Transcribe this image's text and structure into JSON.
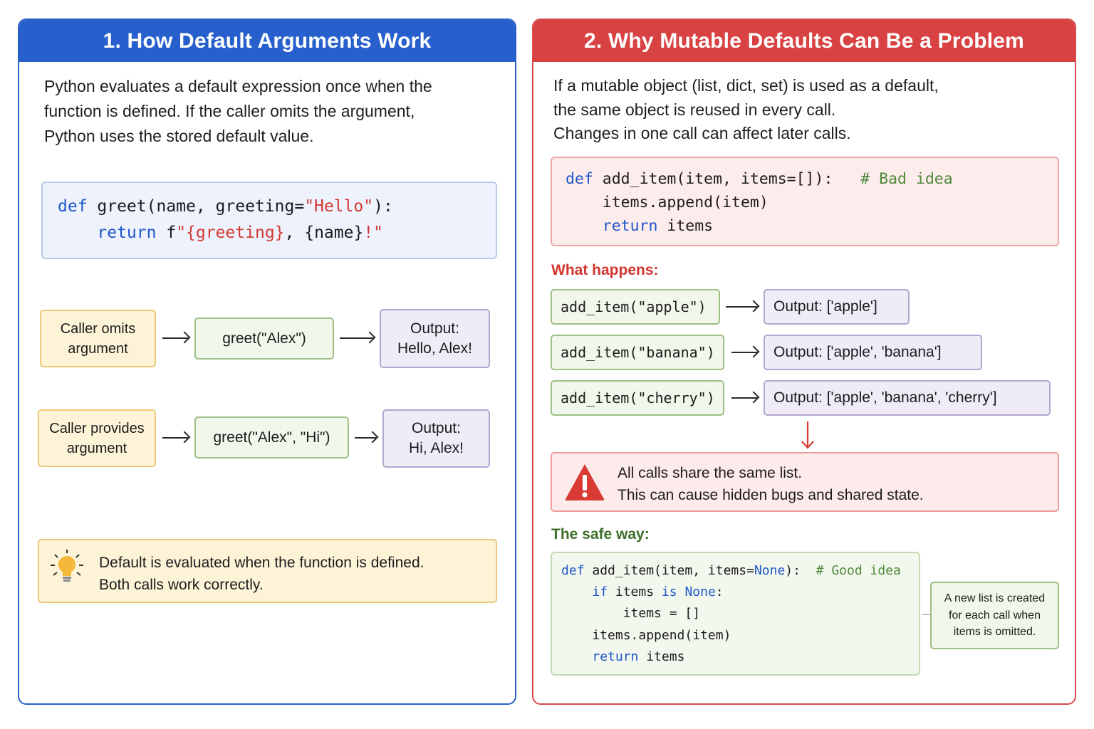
{
  "left_panel": {
    "title": "1. How Default Arguments Work",
    "intro": [
      "Python evaluates a default expression once when the",
      "function is defined. If the caller omits the argument,",
      "Python uses the stored default value."
    ],
    "code": {
      "line1": {
        "kw": "def",
        "name": " greet(name, greeting=",
        "str": "\"Hello\"",
        "tail": "):"
      },
      "line2": {
        "indent": "    ",
        "kw": "return",
        "f": " f",
        "q1": "\"",
        "b1": "{greeting}",
        "mid": ", ",
        "b2": "{name}",
        "end": "!\""
      }
    },
    "flow1": {
      "start": [
        "Caller omits",
        "argument"
      ],
      "call": "greet(\"Alex\")",
      "output": [
        "Output:",
        "Hello, Alex!"
      ]
    },
    "flow2": {
      "start": [
        "Caller provides",
        "argument"
      ],
      "call": "greet(\"Alex\", \"Hi\")",
      "output": [
        "Output:",
        "Hi, Alex!"
      ]
    },
    "tip": [
      "Default is evaluated when the function is defined.",
      "Both calls work correctly."
    ]
  },
  "right_panel": {
    "title": "2. Why Mutable Defaults Can Be a Problem",
    "intro": [
      "If a mutable object (list, dict, set) is used as a default,",
      "the same object is reused in every call.",
      "Changes in one call can affect later calls."
    ],
    "bad_code": {
      "line1": {
        "kw": "def",
        "sig": " add_item(item, items=[]):   ",
        "comment": "# Bad idea"
      },
      "line2": {
        "text": "    items.append(item)"
      },
      "line3": {
        "indent": "    ",
        "kw": "return",
        "rest": " items"
      }
    },
    "what_happens_label": "What happens:",
    "calls": [
      {
        "call": "add_item(\"apple\")",
        "output": "Output: ['apple']"
      },
      {
        "call": "add_item(\"banana\")",
        "output": "Output: ['apple', 'banana']"
      },
      {
        "call": "add_item(\"cherry\")",
        "output": "Output: ['apple', 'banana', 'cherry']"
      }
    ],
    "warning": [
      "All calls share the same list.",
      "This can cause hidden bugs and shared state."
    ],
    "safe_way_label": "The safe way:",
    "good_code": {
      "line1": {
        "kw": "def",
        "sig": " add_item(item, items=",
        "none": "None",
        "close": "):  ",
        "comment": "# Good idea"
      },
      "line2": {
        "indent": "    ",
        "kw1": "if",
        "mid": " items ",
        "kw2": "is",
        "sp": " ",
        "none": "None",
        "colon": ":"
      },
      "line3": {
        "text": "        items = []"
      },
      "line4": {
        "text": "    items.append(item)"
      },
      "line5": {
        "indent": "    ",
        "kw": "return",
        "rest": " items"
      }
    },
    "note": [
      "A new list is created",
      "for each call when",
      "items is omitted."
    ]
  },
  "colors": {
    "left_accent": "#2760cc",
    "right_accent": "#d94242",
    "keyword": "#1f56c8",
    "string": "#d23a34",
    "comment": "#4f8a3a",
    "label_red": "#d2352f",
    "label_green": "#3e6e2b"
  },
  "icons": {
    "tip": "lightbulb-icon",
    "warning": "warning-triangle-icon",
    "flow_arrow": "right-arrow-icon",
    "down_arrow": "down-arrow-icon"
  }
}
